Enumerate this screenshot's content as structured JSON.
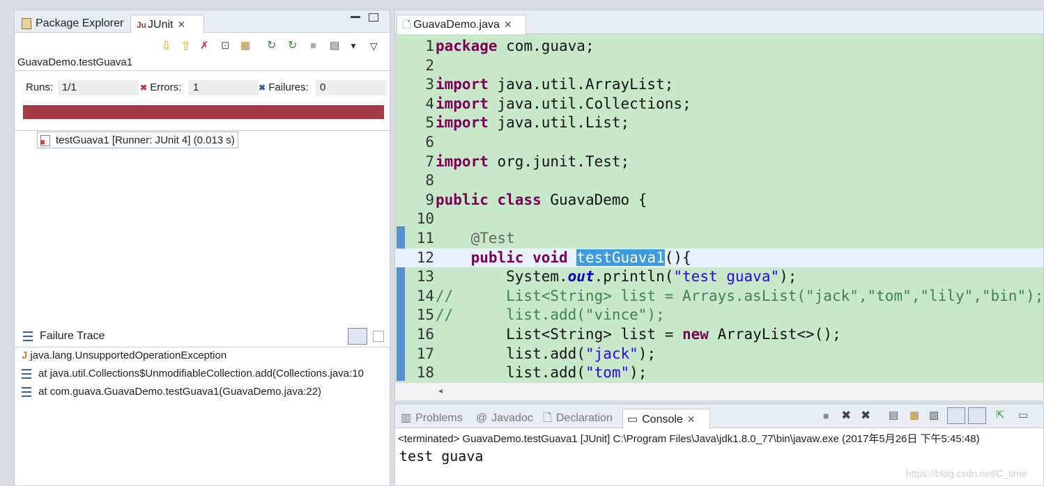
{
  "left_panel": {
    "tabs": [
      "Package Explorer",
      "JUnit"
    ],
    "test_label": "GuavaDemo.testGuava1",
    "counters": {
      "runs_label": "Runs:",
      "runs_value": "1/1",
      "errors_label": "Errors:",
      "errors_value": "1",
      "failures_label": "Failures:",
      "failures_value": "0"
    },
    "progress_color": "#a33a45",
    "tree_item": "testGuava1 [Runner: JUnit 4] (0.013 s)",
    "failure_trace": {
      "title": "Failure Trace",
      "lines": [
        "java.lang.UnsupportedOperationException",
        "at java.util.Collections$UnmodifiableCollection.add(Collections.java:10",
        "at com.guava.GuavaDemo.testGuava1(GuavaDemo.java:22)"
      ]
    }
  },
  "editor": {
    "tab": "GuavaDemo.java",
    "lines": [
      {
        "n": "1",
        "text": "package com.guava;"
      },
      {
        "n": "2",
        "text": ""
      },
      {
        "n": "3",
        "text": "import java.util.ArrayList;"
      },
      {
        "n": "4",
        "text": "import java.util.Collections;"
      },
      {
        "n": "5",
        "text": "import java.util.List;"
      },
      {
        "n": "6",
        "text": ""
      },
      {
        "n": "7",
        "text": "import org.junit.Test;"
      },
      {
        "n": "8",
        "text": ""
      },
      {
        "n": "9",
        "text": "public class GuavaDemo {"
      },
      {
        "n": "10",
        "text": ""
      },
      {
        "n": "11",
        "text": "    @Test"
      },
      {
        "n": "12",
        "text": "    public void testGuava1(){"
      },
      {
        "n": "13",
        "text": "        System.out.println(\"test guava\");"
      },
      {
        "n": "14",
        "text": "//      List<String> list = Arrays.asList(\"jack\",\"tom\",\"lily\",\"bin\");"
      },
      {
        "n": "15",
        "text": "//      list.add(\"vince\");"
      },
      {
        "n": "16",
        "text": "        List<String> list = new ArrayList<>();"
      },
      {
        "n": "17",
        "text": "        list.add(\"jack\");"
      },
      {
        "n": "18",
        "text": "        list.add(\"tom\");"
      }
    ]
  },
  "console": {
    "tabs": [
      "Problems",
      "Javadoc",
      "Declaration",
      "Console"
    ],
    "terminated": "<terminated> GuavaDemo.testGuava1 [JUnit] C:\\Program Files\\Java\\jdk1.8.0_77\\bin\\javaw.exe (2017年5月26日 下午5:45:48)",
    "output": "test guava"
  },
  "watermark": "https://blog.csdn.net/C_time"
}
